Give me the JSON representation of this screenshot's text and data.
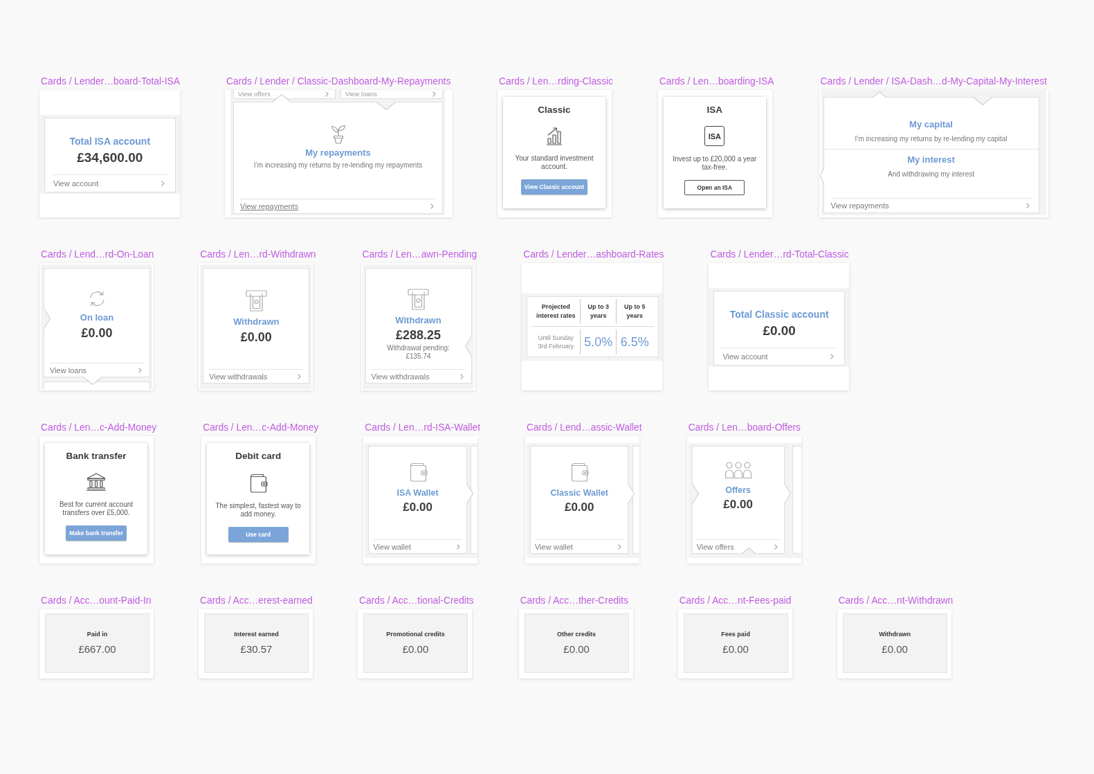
{
  "rows": [
    {
      "artboards": [
        {
          "label": "Cards / Lender…board-Total-ISA",
          "kind": "total",
          "title": "Total ISA account",
          "amount": "£34,600.00",
          "link": "View account"
        },
        {
          "label": "Cards / Lender / Classic-Dashboard-My-Repayments",
          "kind": "feature",
          "adjacent_links": [
            "View offers",
            "View loans"
          ],
          "title": "My repayments",
          "description": "I’m increasing my returns by re-lending my repayments",
          "link": "View repayments"
        },
        {
          "label": "Cards / Len…rding-Classic",
          "kind": "action",
          "title": "Classic",
          "description": "Your standard investment account.",
          "button": "View Classic account"
        },
        {
          "label": "Cards / Len…boarding-ISA",
          "kind": "action",
          "title": "ISA",
          "badge": "ISA",
          "description": "Invest up to £20,000 a year tax-free.",
          "button": "Open an ISA"
        },
        {
          "label": "Cards / Lender / ISA-Dash…d-My-Capital-My-Interest",
          "kind": "split",
          "sections": [
            {
              "title": "My capital",
              "description": "I’m increasing my returns by re-lending my capital"
            },
            {
              "title": "My interest",
              "description": "And withdrawing my interest"
            }
          ],
          "link": "View repayments"
        }
      ]
    },
    {
      "artboards": [
        {
          "label": "Cards / Lend…rd-On-Loan",
          "kind": "stat",
          "title": "On loan",
          "amount": "£0.00",
          "link": "View loans"
        },
        {
          "label": "Cards / Len…rd-Withdrawn",
          "kind": "stat",
          "title": "Withdrawn",
          "amount": "£0.00",
          "link": "View withdrawals"
        },
        {
          "label": "Cards / Len…awn-Pending",
          "kind": "stat",
          "title": "Withdrawn",
          "amount": "£288.25",
          "note": "Withdrawal pending: £135.74",
          "link": "View withdrawals"
        },
        {
          "label": "Cards / Lender…ashboard-Rates",
          "kind": "rates",
          "table": {
            "columns": [
              "Projected interest rates",
              "Up to 3 years",
              "Up to 5 years"
            ],
            "rows": [
              [
                "Until Sunday 3rd February",
                "5.0%",
                "6.5%"
              ]
            ]
          }
        },
        {
          "label": "Cards / Lender…rd-Total-Classic",
          "kind": "total",
          "title": "Total Classic account",
          "amount": "£0.00",
          "link": "View account"
        }
      ]
    },
    {
      "artboards": [
        {
          "label": "Cards / Len…c-Add-Money",
          "kind": "action",
          "title": "Bank transfer",
          "description": "Best for current account transfers over £5,000.",
          "button": "Make bank transfer"
        },
        {
          "label": "Cards / Len…c-Add-Money",
          "kind": "action",
          "title": "Debit card",
          "description": "The simplest, fastest way to add money.",
          "button": "Use card"
        },
        {
          "label": "Cards / Len…rd-ISA-Wallet",
          "kind": "wallet",
          "title": "ISA Wallet",
          "amount": "£0.00",
          "link": "View wallet"
        },
        {
          "label": "Cards / Lend…assic-Wallet",
          "kind": "wallet",
          "title": "Classic Wallet",
          "amount": "£0.00",
          "link": "View wallet"
        },
        {
          "label": "Cards / Len…board-Offers",
          "kind": "wallet",
          "title": "Offers",
          "amount": "£0.00",
          "link": "View offers"
        }
      ]
    },
    {
      "artboards": [
        {
          "label": "Cards / Acc…ount-Paid-In",
          "kind": "summary",
          "title": "Paid in",
          "amount": "£667.00"
        },
        {
          "label": "Cards / Acc…erest-earned",
          "kind": "summary",
          "title": "Interest earned",
          "amount": "£30.57"
        },
        {
          "label": "Cards / Acc…tional-Credits",
          "kind": "summary",
          "title": "Promotional credits",
          "amount": "£0.00"
        },
        {
          "label": "Cards / Acc…ther-Credits",
          "kind": "summary",
          "title": "Other credits",
          "amount": "£0.00"
        },
        {
          "label": "Cards / Acc…nt-Fees-paid",
          "kind": "summary",
          "title": "Fees paid",
          "amount": "£0.00"
        },
        {
          "label": "Cards / Acc…nt-Withdrawn",
          "kind": "summary",
          "title": "Withdrawn",
          "amount": "£0.00"
        }
      ]
    }
  ]
}
